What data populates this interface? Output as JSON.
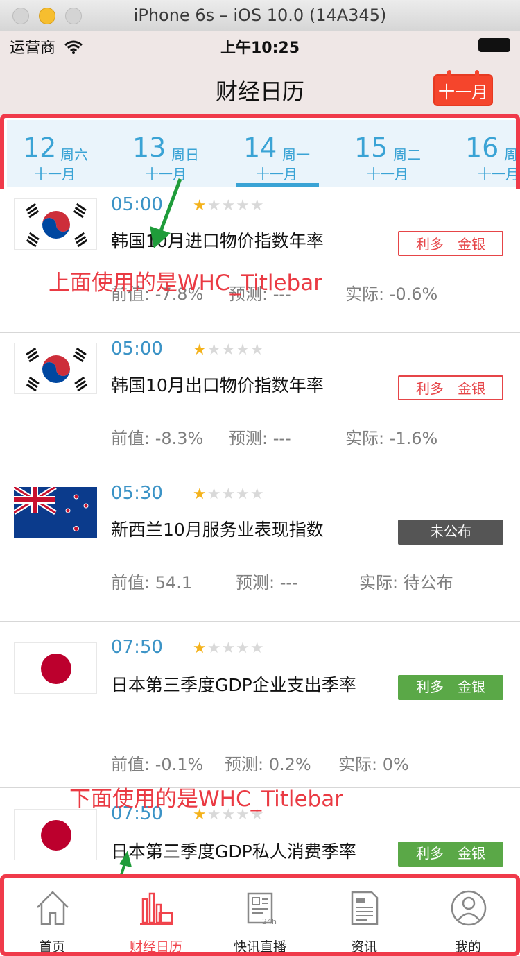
{
  "simulator": {
    "title": "iPhone 6s – iOS 10.0 (14A345)"
  },
  "status": {
    "carrier": "运营商",
    "time": "上午10:25"
  },
  "nav": {
    "title": "财经日历",
    "calendar_label": "十一月"
  },
  "dates": [
    {
      "day": "12",
      "weekday": "周六",
      "month": "十一月"
    },
    {
      "day": "13",
      "weekday": "周日",
      "month": "十一月"
    },
    {
      "day": "14",
      "weekday": "周一",
      "month": "十一月"
    },
    {
      "day": "15",
      "weekday": "周二",
      "month": "十一月"
    },
    {
      "day": "16",
      "weekday": "周",
      "month": "十一月"
    }
  ],
  "rows": [
    {
      "flag": "south-korea",
      "time": "05:00",
      "title": "韩国10月进口物价指数年率",
      "tag": "利多　金银",
      "prev": "前值: -7.8%",
      "forecast": "预测: ---",
      "actual": "实际: -0.6%"
    },
    {
      "flag": "south-korea",
      "time": "05:00",
      "title": "韩国10月出口物价指数年率",
      "tag": "利多　金银",
      "prev": "前值: -8.3%",
      "forecast": "预测: ---",
      "actual": "实际: -1.6%"
    },
    {
      "flag": "new-zealand",
      "time": "05:30",
      "title": "新西兰10月服务业表现指数",
      "tag": "未公布",
      "prev": "前值: 54.1",
      "forecast": "预测: ---",
      "actual": "实际: 待公布"
    },
    {
      "flag": "japan",
      "time": "07:50",
      "title": "日本第三季度GDP企业支出季率",
      "tag": "利多　金银",
      "prev": "前值: -0.1%",
      "forecast": "预测: 0.2%",
      "actual": "实际: 0%"
    },
    {
      "flag": "japan",
      "time": "07:50",
      "title": "日本第三季度GDP私人消费季率",
      "tag": "利多　金银"
    }
  ],
  "annotations": {
    "top": "上面使用的是WHC_Titlebar",
    "bottom": "下面使用的是WHC_Titlebar"
  },
  "tabs": [
    {
      "label": "首页",
      "icon": "home-icon"
    },
    {
      "label": "财经日历",
      "icon": "finance-calendar-icon"
    },
    {
      "label": "快讯直播",
      "icon": "news-24h-icon"
    },
    {
      "label": "资讯",
      "icon": "document-icon"
    },
    {
      "label": "我的",
      "icon": "profile-icon"
    }
  ],
  "colors": {
    "accent": "#3aa3d5",
    "highlight": "#f03a4a",
    "bull": "#5aa847",
    "pending": "#555555"
  },
  "rating_stars": {
    "filled": 1,
    "total": 5
  }
}
